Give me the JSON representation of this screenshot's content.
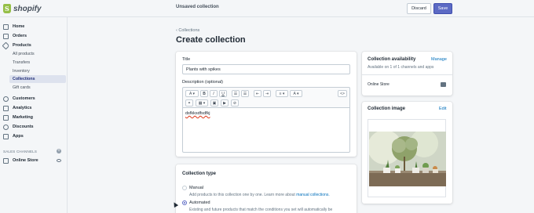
{
  "brand": {
    "name": "shopify"
  },
  "topbar": {
    "title": "Unsaved collection",
    "discard_label": "Discard",
    "save_label": "Save"
  },
  "sidebar": {
    "items": [
      {
        "label": "Home",
        "icon": "home-icon"
      },
      {
        "label": "Orders",
        "icon": "orders-icon"
      },
      {
        "label": "Products",
        "icon": "tag-icon"
      },
      {
        "label": "Customers",
        "icon": "customers-icon"
      },
      {
        "label": "Analytics",
        "icon": "analytics-icon"
      },
      {
        "label": "Marketing",
        "icon": "marketing-icon"
      },
      {
        "label": "Discounts",
        "icon": "discounts-icon"
      },
      {
        "label": "Apps",
        "icon": "apps-icon"
      }
    ],
    "product_subitems": [
      "All products",
      "Transfers",
      "Inventory",
      "Collections",
      "Gift cards"
    ],
    "active_subitem": "Collections",
    "sales_channels_label": "SALES CHANNELS",
    "online_store_label": "Online Store"
  },
  "page": {
    "breadcrumb": "Collections",
    "title": "Create collection"
  },
  "form": {
    "title_label": "Title",
    "title_value": "Plants with spikes",
    "description_label": "Description (optional)",
    "description_value": "dsfkksdfsdfkj",
    "toolbar": {
      "bold": "B",
      "italic": "I",
      "underline": "U",
      "code": "<>"
    }
  },
  "collection_type": {
    "title": "Collection type",
    "manual_label": "Manual",
    "manual_desc_prefix": "Add products to this collection one by one. Learn more about",
    "manual_desc_link": "manual collections.",
    "automated_label": "Automated",
    "automated_desc": "Existing and future products that match the conditions you set will automatically be",
    "selected": "Automated"
  },
  "availability": {
    "title": "Collection availability",
    "manage_label": "Manage",
    "subtitle": "Available on 1 of 1 channels and apps",
    "channel": "Online Store"
  },
  "collection_image": {
    "title": "Collection image",
    "edit_label": "Edit"
  },
  "colors": {
    "accent": "#5c6ac4",
    "link": "#006fbb",
    "active_nav": "#202e78",
    "brand_green": "#95bf47"
  }
}
